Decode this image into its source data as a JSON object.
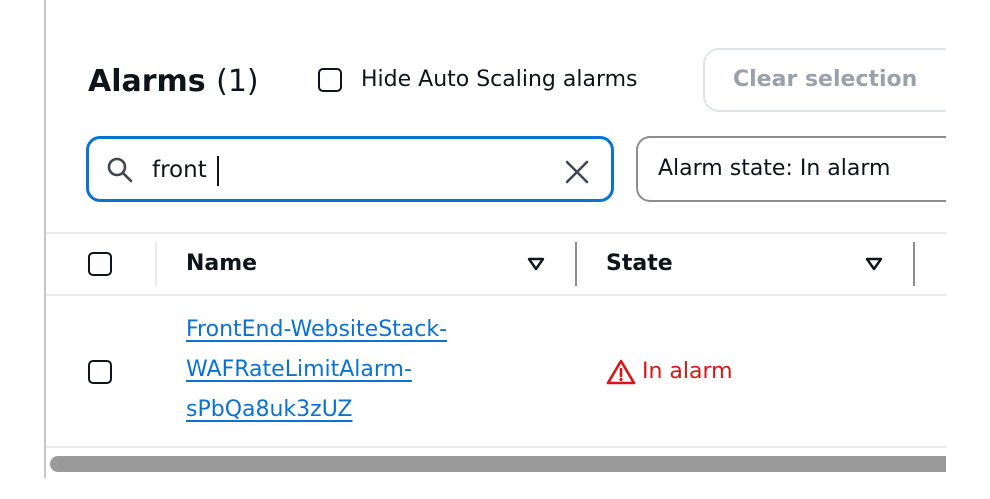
{
  "header": {
    "title": "Alarms",
    "count": "(1)",
    "hide_auto_scaling_label": "Hide Auto Scaling alarms",
    "clear_selection_label": "Clear selection"
  },
  "search": {
    "value": "front",
    "placeholder": ""
  },
  "filter": {
    "label": "Alarm state: In alarm"
  },
  "table": {
    "columns": [
      {
        "label": "Name"
      },
      {
        "label": "State"
      }
    ],
    "rows": [
      {
        "name": "FrontEnd-WebsiteStack-WAFRateLimitAlarm-sPbQa8uk3zUZ",
        "state": "In alarm"
      }
    ]
  },
  "colors": {
    "accent": "#0972d3",
    "alarm": "#d91515",
    "text": "#0f141a",
    "disabled": "#9aa1ab"
  },
  "icons": [
    "search-icon",
    "clear-icon",
    "sort-icon",
    "warning-icon"
  ]
}
